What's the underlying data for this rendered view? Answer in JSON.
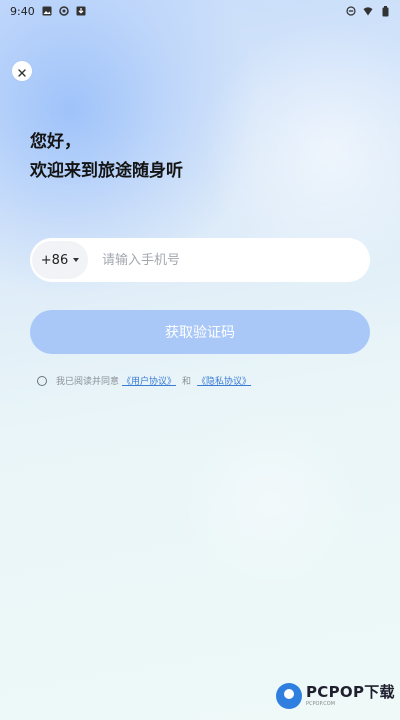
{
  "status_bar": {
    "time": "9:40",
    "left_icons": [
      "image-icon",
      "settings-icon",
      "download-icon"
    ],
    "right_icons": [
      "dnd-icon",
      "wifi-icon",
      "battery-icon"
    ]
  },
  "greeting": {
    "line1": "您好，",
    "line2": "欢迎来到旅途随身听"
  },
  "phone": {
    "country_code": "+86",
    "placeholder": "请输入手机号",
    "value": ""
  },
  "get_code_button": "获取验证码",
  "agreement": {
    "checked": false,
    "prefix": "我已阅读并同意",
    "user_agreement": "《用户协议》",
    "and": "和",
    "privacy_agreement": "《隐私协议》"
  },
  "watermark": {
    "brand": "PCPOP下载",
    "sub": "PCPOP.COM"
  },
  "colors": {
    "primary_button": "#a9c8f7",
    "link": "#3a7bd5",
    "watermark_blue": "#2f7fe0"
  }
}
